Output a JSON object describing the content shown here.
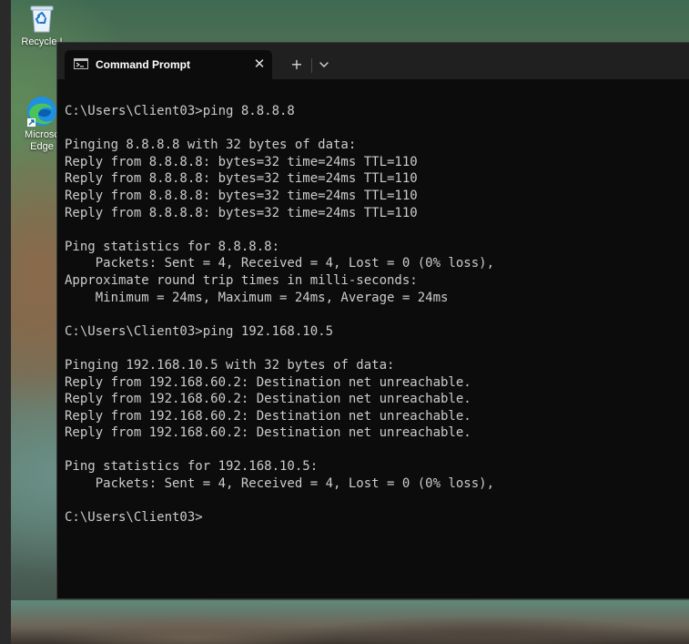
{
  "desktop": {
    "icons": [
      {
        "label": "Recycle Bin",
        "visible_label": "Recycle I",
        "icon": "recycle-bin-icon"
      },
      {
        "label": "Microsoft Edge",
        "visible_label_line1": "Microsc",
        "visible_label_line2": "Edge",
        "icon": "edge-icon"
      }
    ]
  },
  "window": {
    "tab_title": "Command Prompt",
    "tab_icon": "cmd-icon",
    "close_glyph": "✕",
    "new_tab_glyph": "+",
    "dropdown_icon": "chevron-down-icon"
  },
  "console": {
    "lines": [
      "C:\\Users\\Client03>ping 8.8.8.8",
      "",
      "Pinging 8.8.8.8 with 32 bytes of data:",
      "Reply from 8.8.8.8: bytes=32 time=24ms TTL=110",
      "Reply from 8.8.8.8: bytes=32 time=24ms TTL=110",
      "Reply from 8.8.8.8: bytes=32 time=24ms TTL=110",
      "Reply from 8.8.8.8: bytes=32 time=24ms TTL=110",
      "",
      "Ping statistics for 8.8.8.8:",
      "    Packets: Sent = 4, Received = 4, Lost = 0 (0% loss),",
      "Approximate round trip times in milli-seconds:",
      "    Minimum = 24ms, Maximum = 24ms, Average = 24ms",
      "",
      "C:\\Users\\Client03>ping 192.168.10.5",
      "",
      "Pinging 192.168.10.5 with 32 bytes of data:",
      "Reply from 192.168.60.2: Destination net unreachable.",
      "Reply from 192.168.60.2: Destination net unreachable.",
      "Reply from 192.168.60.2: Destination net unreachable.",
      "Reply from 192.168.60.2: Destination net unreachable.",
      "",
      "Ping statistics for 192.168.10.5:",
      "    Packets: Sent = 4, Received = 4, Lost = 0 (0% loss),",
      "",
      "C:\\Users\\Client03>"
    ]
  },
  "colors": {
    "terminal_bg": "#0c0c0c",
    "terminal_text": "#cccccc",
    "titlebar_bg": "#202020",
    "edge_blue": "#1f8fe0",
    "edge_green": "#4cc35a"
  }
}
